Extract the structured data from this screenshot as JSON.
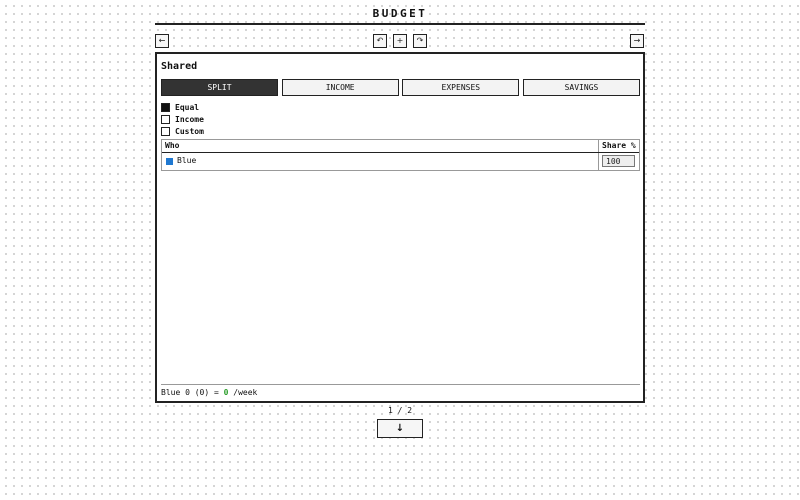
{
  "header": {
    "title": "BUDGET"
  },
  "toolbar": {
    "back_glyph": "←",
    "undo_glyph": "↶",
    "add_glyph": "+",
    "redo_glyph": "↷",
    "forward_glyph": "→"
  },
  "panel": {
    "title": "Shared",
    "tabs": [
      {
        "label": "SPLIT",
        "active": true
      },
      {
        "label": "INCOME",
        "active": false
      },
      {
        "label": "EXPENSES",
        "active": false
      },
      {
        "label": "SAVINGS",
        "active": false
      }
    ],
    "split_options": [
      {
        "label": "Equal",
        "checked": true
      },
      {
        "label": "Income",
        "checked": false
      },
      {
        "label": "Custom",
        "checked": false
      }
    ],
    "table": {
      "headers": {
        "who": "Who",
        "share": "Share %"
      },
      "rows": [
        {
          "name": "Blue",
          "color": "#1f78d1",
          "share": "100"
        }
      ]
    },
    "footer": {
      "prefix": "Blue 0 (0) = ",
      "value": "0",
      "value_color": "#2a9d2a",
      "suffix": " /week"
    }
  },
  "pagination": {
    "label": "1 / 2",
    "down_glyph": "↓"
  }
}
